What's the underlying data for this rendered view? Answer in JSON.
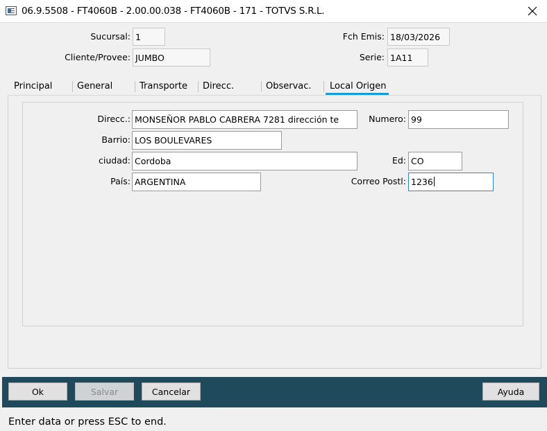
{
  "window": {
    "title": "06.9.5508 - FT4060B - 2.00.00.038 - FT4060B - 171 - TOTVS S.R.L.",
    "icon": "app-window-icon",
    "close_icon": "close-icon"
  },
  "header": {
    "sucursal": {
      "label": "Sucursal:",
      "value": "1"
    },
    "cliente": {
      "label": "Cliente/Provee:",
      "value": "JUMBO"
    },
    "fch_emis": {
      "label": "Fch Emis:",
      "value": "18/03/2026"
    },
    "serie": {
      "label": "Serie:",
      "value": "1A11"
    }
  },
  "tabs": [
    {
      "label": "Principal",
      "active": false
    },
    {
      "label": "General",
      "active": false
    },
    {
      "label": "Transporte",
      "active": false
    },
    {
      "label": "Direcc.",
      "active": false
    },
    {
      "label": "Observac.",
      "active": false
    },
    {
      "label": "Local Origen",
      "active": true
    }
  ],
  "accent_color": "#1a9ad6",
  "form": {
    "direcc": {
      "label": "Direcc.:",
      "value": "MONSEÑOR PABLO CABRERA 7281 dirección te"
    },
    "numero": {
      "label": "Numero:",
      "value": "99"
    },
    "barrio": {
      "label": "Barrio:",
      "value": "LOS BOULEVARES"
    },
    "ciudad": {
      "label": "ciudad:",
      "value": "Cordoba"
    },
    "ed": {
      "label": "Ed:",
      "value": "CO"
    },
    "pais": {
      "label": "País:",
      "value": "ARGENTINA"
    },
    "correo": {
      "label": "Correo Postl:",
      "value": "1236"
    }
  },
  "buttons": {
    "ok": "Ok",
    "salvar": "Salvar",
    "cancelar": "Cancelar",
    "ayuda": "Ayuda"
  },
  "status": {
    "text": "Enter data or press ESC to end."
  }
}
